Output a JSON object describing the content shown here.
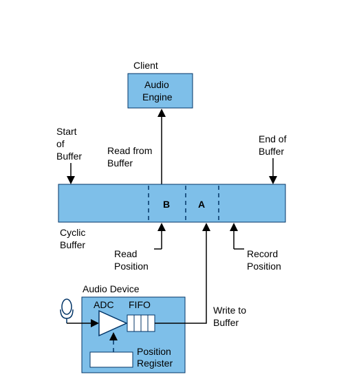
{
  "client": {
    "label": "Client",
    "box_line1": "Audio",
    "box_line2": "Engine"
  },
  "buffer": {
    "start_l1": "Start",
    "start_l2": "of",
    "start_l3": "Buffer",
    "end_l1": "End of",
    "end_l2": "Buffer",
    "read_from_l1": "Read from",
    "read_from_l2": "Buffer",
    "cyclic_l1": "Cyclic",
    "cyclic_l2": "Buffer",
    "read_pos_l1": "Read",
    "read_pos_l2": "Position",
    "record_pos_l1": "Record",
    "record_pos_l2": "Position",
    "region_b": "B",
    "region_a": "A"
  },
  "device": {
    "label": "Audio Device",
    "adc": "ADC",
    "fifo": "FIFO",
    "pos_reg_l1": "Position",
    "pos_reg_l2": "Register",
    "write_l1": "Write to",
    "write_l2": "Buffer"
  }
}
